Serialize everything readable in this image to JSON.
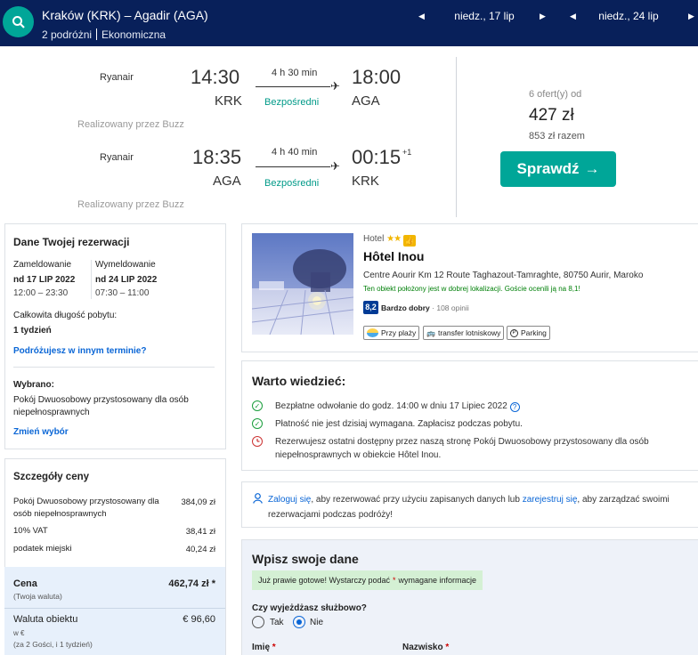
{
  "header": {
    "route": "Kraków (KRK) – Agadir (AGA)",
    "travellers": "2 podróżni",
    "cabin": "Ekonomiczna",
    "date_out": "niedz., 17 lip",
    "date_back": "niedz., 24 lip"
  },
  "flights": {
    "outbound": {
      "airline": "Ryanair",
      "dep_time": "14:30",
      "dep_code": "KRK",
      "duration": "4 h 30 min",
      "stops": "Bezpośredni",
      "arr_time": "18:00",
      "arr_code": "AGA",
      "operated": "Realizowany przez Buzz"
    },
    "inbound": {
      "airline": "Ryanair",
      "dep_time": "18:35",
      "dep_code": "AGA",
      "duration": "4 h 40 min",
      "stops": "Bezpośredni",
      "arr_time": "00:15",
      "arr_plus": "+1",
      "arr_code": "KRK",
      "operated": "Realizowany przez Buzz"
    },
    "offers": "6 ofert(y) od",
    "price": "427 zł",
    "total": "853 zł razem",
    "check_button": "Sprawdź"
  },
  "booking": {
    "title": "Dane Twojej rezerwacji",
    "checkin_label": "Zameldowanie",
    "checkin_date": "nd 17 LIP 2022",
    "checkin_time": "12:00 – 23:30",
    "checkout_label": "Wymeldowanie",
    "checkout_date": "nd 24 LIP 2022",
    "checkout_time": "07:30 – 11:00",
    "length_label": "Całkowita długość pobytu:",
    "length_value": "1 tydzień",
    "change_dates_link": "Podróżujesz w innym terminie?",
    "selected_label": "Wybrano:",
    "selected_value": "Pokój Dwuosobowy przystosowany dla osób niepełnosprawnych",
    "change_selection_link": "Zmień wybór"
  },
  "price_details": {
    "title": "Szczegóły ceny",
    "rows": [
      {
        "label": "Pokój Dwuosobowy przystosowany dla osób niepełnosprawnych",
        "value": "384,09 zł"
      },
      {
        "label": "10% VAT",
        "value": "38,41 zł"
      },
      {
        "label": "podatek miejski",
        "value": "40,24 zł"
      }
    ],
    "total_label": "Cena",
    "total_note": "(Twoja waluta)",
    "total_value": "462,74 zł *",
    "property_label": "Waluta obiektu",
    "property_note1": "w €",
    "property_note2": "(za 2 Gości, i 1 tydzień)",
    "property_value": "€ 96,60"
  },
  "hotel": {
    "type": "Hotel",
    "stars": "★★",
    "name": "Hôtel Inou",
    "address": "Centre Aourir Km 12 Route Taghazout-Tamraghte, 80750 Aurir, Maroko",
    "location_note": "Ten obiekt położony jest w dobrej lokalizacji. Goście ocenili ją na 8,1!",
    "score": "8,2",
    "score_label": "Bardzo dobry",
    "reviews": "· 108 opinii",
    "amenities": [
      "Przy plaży",
      "transfer lotniskowy",
      "Parking"
    ]
  },
  "good_to_know": {
    "title": "Warto wiedzieć:",
    "item1": "Bezpłatne odwołanie do godz. 14:00 w dniu 17 Lipiec 2022",
    "item2": "Płatność nie jest dzisiaj wymagana. Zapłacisz podczas pobytu.",
    "item3": "Rezerwujesz ostatni dostępny przez naszą stronę Pokój Dwuosobowy przystosowany dla osób niepełnosprawnych w obiekcie Hôtel Inou."
  },
  "signin": {
    "link1": "Zaloguj się",
    "text1": ", aby rezerwować przy użyciu zapisanych danych lub ",
    "link2": "zarejestruj się",
    "text2": ", aby zarządzać swoimi rezerwacjami podczas podróży!"
  },
  "form": {
    "title": "Wpisz swoje dane",
    "notice_pre": "Już prawie gotowe! Wystarczy podać",
    "notice_star": "*",
    "notice_post": "wymagane informacje",
    "business_q": "Czy wyjeżdżasz służbowo?",
    "yes": "Tak",
    "no": "Nie",
    "first_name": "Imię",
    "last_name": "Nazwisko",
    "req": "*"
  },
  "colors": {
    "header": "#08205a",
    "accent": "#00a698",
    "link": "#0a66d6"
  }
}
